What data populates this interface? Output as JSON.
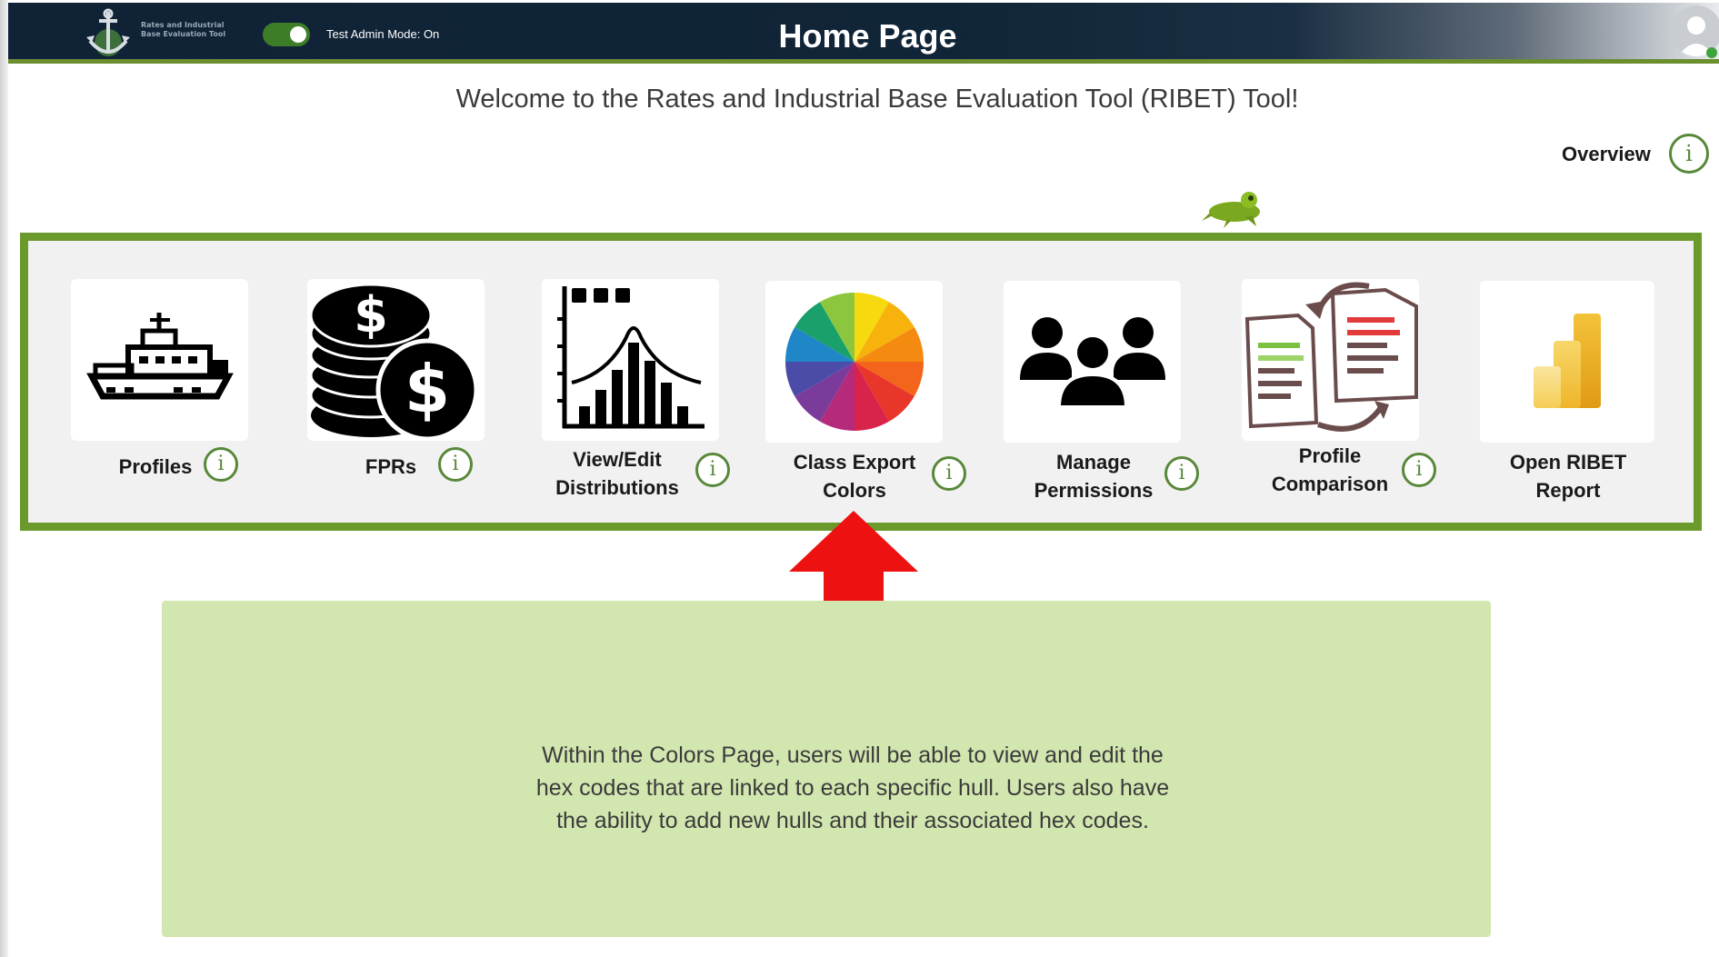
{
  "header": {
    "title": "Home Page",
    "logo_text": "Rates and Industrial Base Evaluation Tool",
    "admin_toggle_label": "Test Admin Mode: On",
    "admin_toggle_on": true
  },
  "welcome": {
    "text": "Welcome to the Rates and Industrial Base Evaluation Tool (RIBET) Tool!"
  },
  "overview": {
    "label": "Overview",
    "info_glyph": "i"
  },
  "nav": {
    "items": [
      {
        "line1": "Profiles",
        "line2": "",
        "icon": "ship-icon",
        "info_glyph": "i"
      },
      {
        "line1": "FPRs",
        "line2": "",
        "icon": "dollar-coins-icon",
        "info_glyph": "i"
      },
      {
        "line1": "View/Edit",
        "line2": "Distributions",
        "icon": "distribution-chart-icon",
        "info_glyph": "i"
      },
      {
        "line1": "Class Export",
        "line2": "Colors",
        "icon": "color-wheel-icon",
        "info_glyph": "i"
      },
      {
        "line1": "Manage",
        "line2": "Permissions",
        "icon": "people-group-icon",
        "info_glyph": "i"
      },
      {
        "line1": "Profile",
        "line2": "Comparison",
        "icon": "document-compare-icon",
        "info_glyph": "i"
      },
      {
        "line1": "Open RIBET",
        "line2": "Report",
        "icon": "power-bi-icon"
      }
    ]
  },
  "description": {
    "text": "Within the Colors Page, users will be able to view and edit the hex codes that are linked to each specific hull. Users also have the ability to add new hulls and their associated hex codes."
  },
  "colors": {
    "header_bg": "#112538",
    "accent_green": "#6b9a2c",
    "info_green": "#58883a",
    "desc_bg": "#d2e6af",
    "arrow_red": "#ee1111"
  }
}
